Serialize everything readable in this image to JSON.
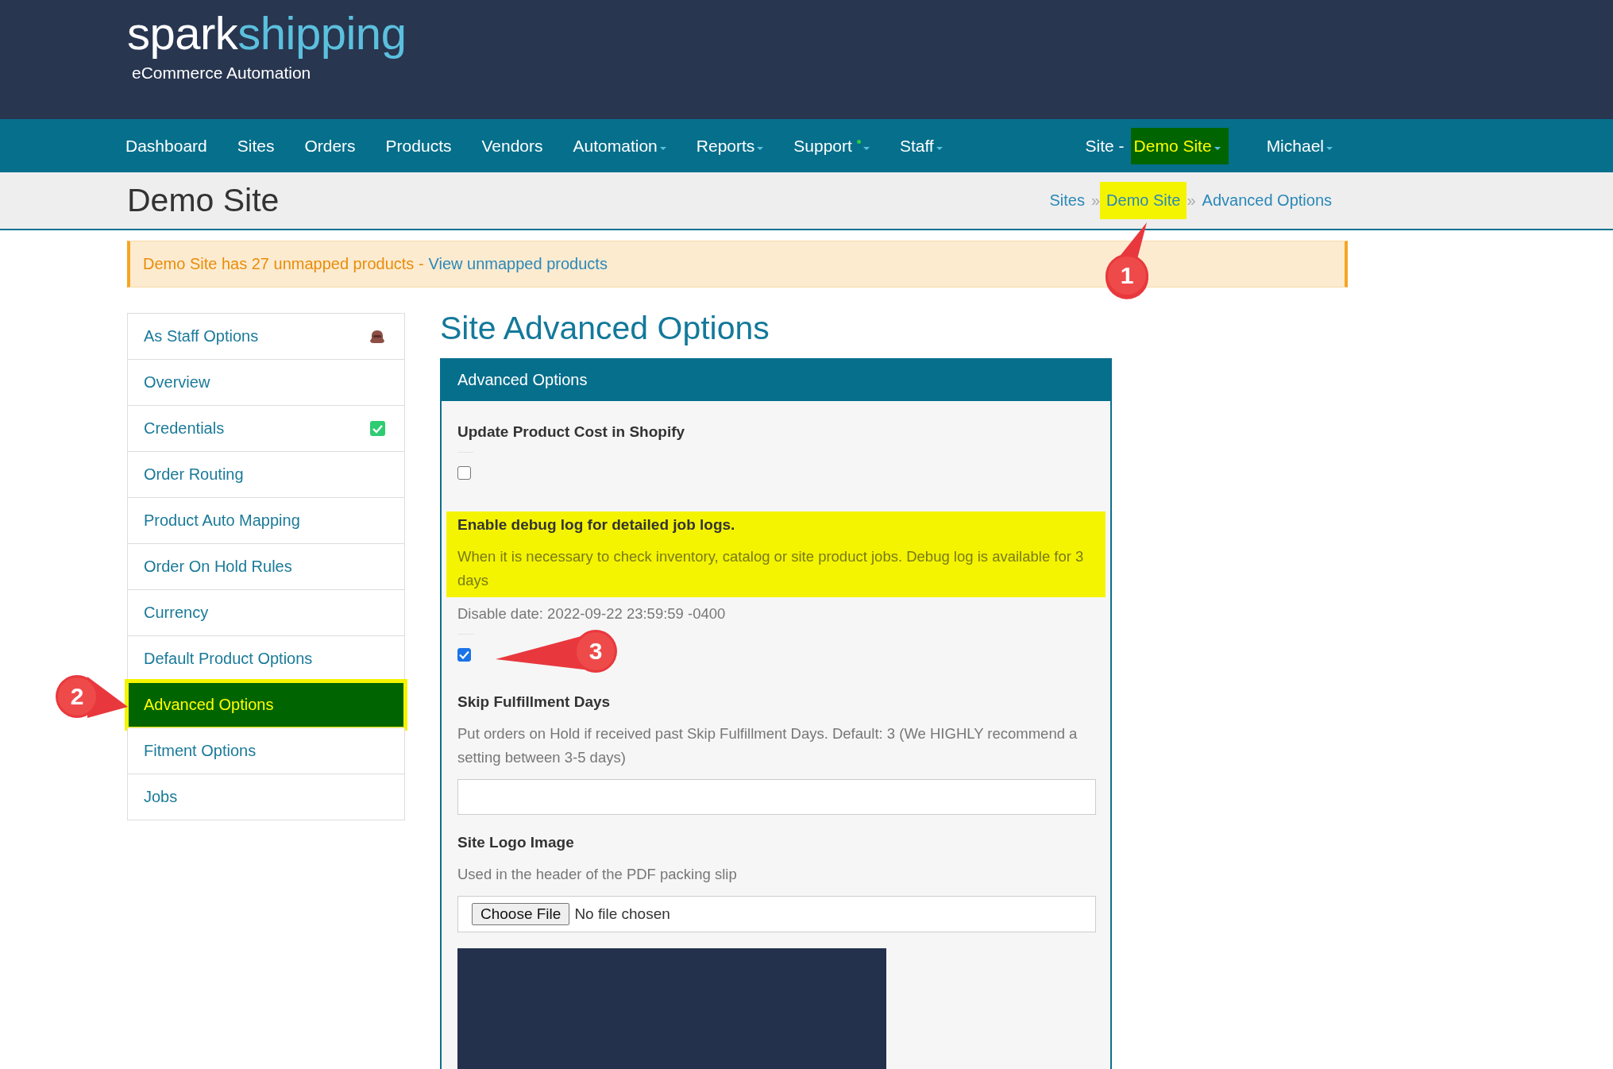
{
  "header": {
    "logo": {
      "part_1": "spark",
      "part_2": "shipping"
    },
    "tagline": "eCommerce Automation"
  },
  "nav": {
    "items": [
      {
        "label": "Dashboard",
        "dropdown": false
      },
      {
        "label": "Sites",
        "dropdown": false
      },
      {
        "label": "Orders",
        "dropdown": false
      },
      {
        "label": "Products",
        "dropdown": false
      },
      {
        "label": "Vendors",
        "dropdown": false
      },
      {
        "label": "Automation",
        "dropdown": true
      },
      {
        "label": "Reports",
        "dropdown": true
      },
      {
        "label": "Support",
        "dropdown": true,
        "notification": true
      },
      {
        "label": "Staff",
        "dropdown": true
      }
    ],
    "site_selector": {
      "label": "Site -",
      "value": "Demo Site",
      "dropdown": true,
      "highlighted": true
    },
    "user_menu": {
      "label": "Michael",
      "dropdown": true
    }
  },
  "page_title": "Demo Site",
  "breadcrumb": {
    "separator": "»",
    "items": [
      {
        "label": "Sites",
        "highlighted": false
      },
      {
        "label": "Demo Site",
        "highlighted": true,
        "callout": "1"
      },
      {
        "label": "Advanced Options",
        "highlighted": false
      }
    ]
  },
  "alert": {
    "text": "Demo Site has 27 unmapped products -",
    "link": "View unmapped products"
  },
  "sidebar": {
    "items": [
      {
        "label": "As Staff Options",
        "selected": false,
        "highlighted": false,
        "kind": "staff"
      },
      {
        "label": "Overview",
        "selected": false,
        "highlighted": false
      },
      {
        "label": "Credentials",
        "selected": false,
        "highlighted": false,
        "kind": "verified"
      },
      {
        "label": "Order Routing",
        "selected": false,
        "highlighted": false
      },
      {
        "label": "Product Auto Mapping",
        "selected": false,
        "highlighted": false
      },
      {
        "label": "Order On Hold Rules",
        "selected": false,
        "highlighted": false
      },
      {
        "label": "Currency",
        "selected": false,
        "highlighted": false
      },
      {
        "label": "Default Product Options",
        "selected": false,
        "highlighted": false
      },
      {
        "label": "Advanced Options",
        "selected": true,
        "highlighted": true,
        "callout": "2"
      },
      {
        "label": "Fitment Options",
        "selected": false,
        "highlighted": false
      },
      {
        "label": "Jobs",
        "selected": false,
        "highlighted": false
      }
    ]
  },
  "heading": "Site Advanced Options",
  "panel": {
    "title": "Advanced Options",
    "fields": [
      {
        "kind": "checkbox",
        "label": "Update Product Cost in Shopify",
        "checked": false,
        "highlighted": false
      },
      {
        "kind": "checkbox",
        "label": "Enable debug log for detailed job logs.",
        "help": "When it is necessary to check inventory, catalog or site product jobs. Debug log is available for 3 days",
        "note": "Disable date: 2022-09-22 23:59:59 -0400",
        "checked": true,
        "highlighted": true,
        "callout": "3"
      },
      {
        "kind": "text",
        "label": "Skip Fulfillment Days",
        "help": "Put orders on Hold if received past Skip Fulfillment Days. Default: 3 (We HIGHLY recommend a setting between 3-5 days)"
      },
      {
        "kind": "file",
        "label": "Site Logo Image",
        "help": "Used in the header of the PDF packing slip",
        "button": "Choose File",
        "status": "No file chosen",
        "preview": true
      }
    ]
  }
}
